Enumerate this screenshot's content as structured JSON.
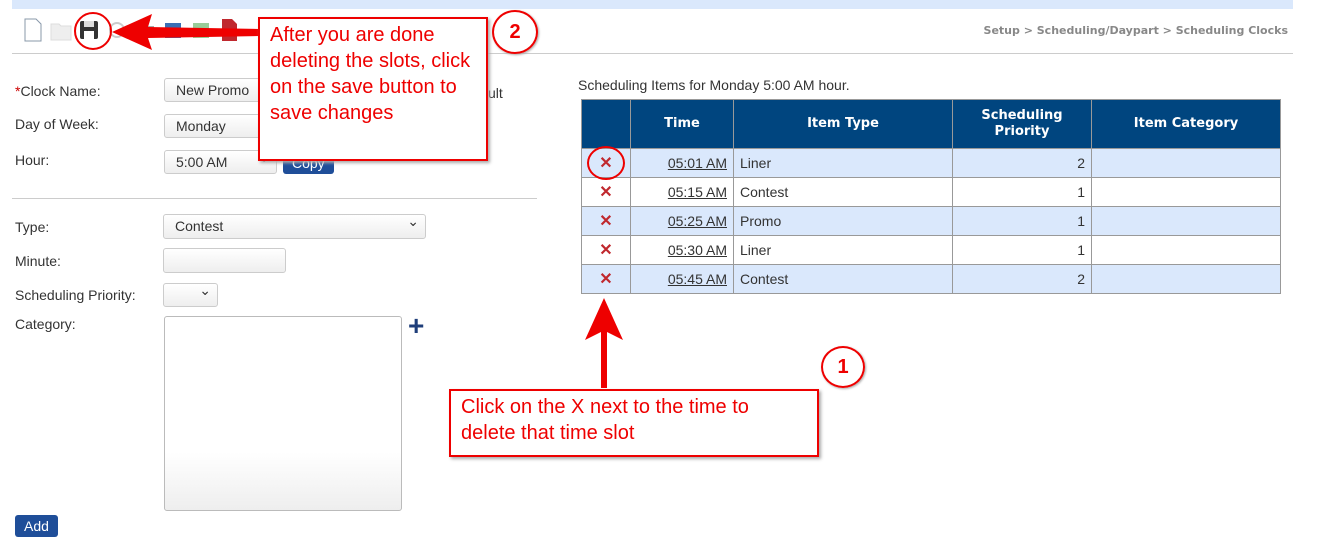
{
  "breadcrumb": "Setup > Scheduling/Daypart > Scheduling Clocks",
  "toolbar": {
    "icons": [
      "new-icon",
      "open-icon",
      "save-icon",
      "refresh-icon",
      "print-icon",
      "word-icon",
      "excel-icon",
      "pdf-icon"
    ]
  },
  "form": {
    "clock_name_required": "*",
    "clock_name_label": "Clock Name:",
    "clock_name_value": "New Promo",
    "default_suffix": "ult",
    "day_label": "Day of Week:",
    "day_value": "Monday",
    "hour_label": "Hour:",
    "hour_value": "5:00 AM",
    "copy_label": "Copy",
    "type_label": "Type:",
    "type_value": "Contest",
    "minute_label": "Minute:",
    "minute_value": "",
    "priority_label": "Scheduling Priority:",
    "priority_value": "",
    "category_label": "Category:",
    "add_label": "Add"
  },
  "table": {
    "caption": "Scheduling Items for Monday 5:00 AM hour.",
    "headers": [
      "",
      "Time",
      "Item Type",
      "Scheduling Priority",
      "Item Category"
    ],
    "rows": [
      {
        "del": "✕",
        "time": "05:01 AM",
        "type": "Liner",
        "priority": "2",
        "category": ""
      },
      {
        "del": "✕",
        "time": "05:15 AM",
        "type": "Contest",
        "priority": "1",
        "category": ""
      },
      {
        "del": "✕",
        "time": "05:25 AM",
        "type": "Promo",
        "priority": "1",
        "category": ""
      },
      {
        "del": "✕",
        "time": "05:30 AM",
        "type": "Liner",
        "priority": "1",
        "category": ""
      },
      {
        "del": "✕",
        "time": "05:45 AM",
        "type": "Contest",
        "priority": "2",
        "category": ""
      }
    ]
  },
  "annotations": {
    "step1": "1",
    "step1_text": "Click on the X next to the time to delete that time slot",
    "step2": "2",
    "step2_text": "After you are done deleting the slots, click on the save button to save changes"
  },
  "colors": {
    "header": "#00457f",
    "row_alt": "#dae8fc",
    "annotation": "#ee0000",
    "button": "#1f4e99"
  }
}
